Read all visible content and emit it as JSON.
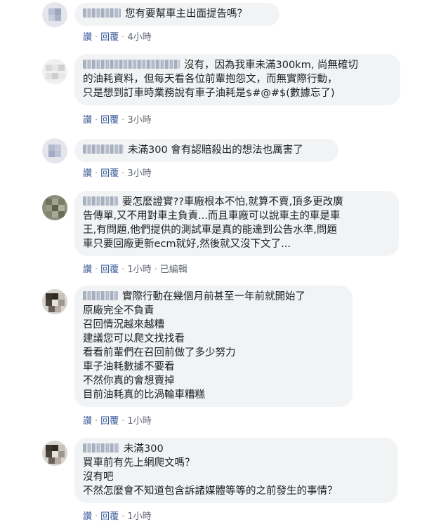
{
  "comments": [
    {
      "author": "",
      "lines": [
        "您有要幫車主出面提告嗎？"
      ],
      "actions": {
        "like": "讚",
        "reply": "回覆",
        "time": "4小時",
        "edited": ""
      }
    },
    {
      "author": "",
      "lines": [
        "沒有，因為我車未滿300km, 尚無確切",
        "的油耗資料，但每天看各位前輩抱怨文，而無實際行動，",
        "只是想到訂車時業務說有車子油耗是$#@#$(數據忘了)"
      ],
      "actions": {
        "like": "讚",
        "reply": "回覆",
        "time": "3小時",
        "edited": ""
      }
    },
    {
      "author": "",
      "lines": [
        "未滿300 會有認賠殺出的想法也厲害了"
      ],
      "actions": {
        "like": "讚",
        "reply": "回覆",
        "time": "3小時",
        "edited": ""
      }
    },
    {
      "author": "",
      "lines": [
        "要怎麼證實??車廠根本不怕,就算不賣,頂多更改廣",
        "告傳單,又不用對車主負責...而且車廠可以說車主的車是車",
        "王,有問題,他們提供的測試車是真的能達到公告水準,問題",
        "車只要回廠更新ecm就好,然後就又沒下文了..."
      ],
      "actions": {
        "like": "讚",
        "reply": "回覆",
        "time": "1小時",
        "edited": "已編輯"
      }
    },
    {
      "author": "",
      "lines": [
        "實際行動在幾個月前甚至一年前就開始了",
        "原廠完全不負責",
        "召回情況越來越糟",
        "建議您可以爬文找找看",
        "看看前輩們在召回前做了多少努力",
        "車子油耗數據不要看",
        "不然你真的會想賣掉",
        "目前油耗真的比渦輪車糟糕"
      ],
      "actions": {
        "like": "讚",
        "reply": "回覆",
        "time": "1小時",
        "edited": ""
      }
    },
    {
      "author": "",
      "lines": [
        "未滿300",
        "買車前有先上網爬文嗎？",
        "沒有吧",
        "不然怎麼會不知道包含訴諸媒體等等的之前發生的事情？"
      ],
      "actions": {
        "like": "讚",
        "reply": "回覆",
        "time": "1小時",
        "edited": ""
      }
    }
  ]
}
